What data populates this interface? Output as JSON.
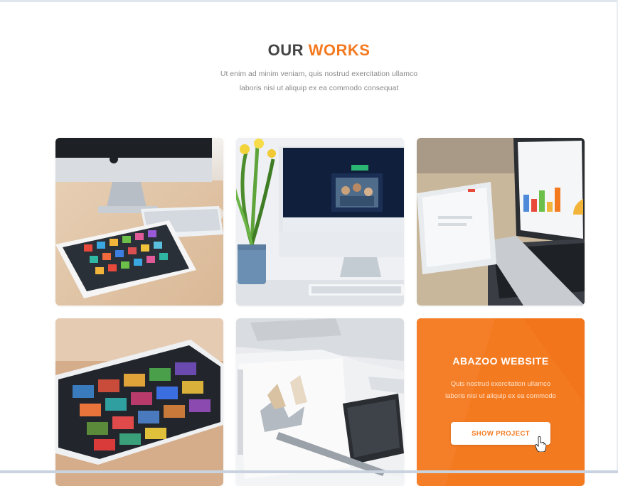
{
  "section": {
    "title_part1": "OUR ",
    "title_part2": "WORKS",
    "subtitle_line1": "Ut enim ad minim veniam, quis nostrud exercitation ullamco",
    "subtitle_line2": "laboris nisi ut aliquip ex ea commodo consequat"
  },
  "colors": {
    "accent": "#f47a20",
    "heading": "#444444",
    "text": "#8a8a8a"
  },
  "portfolio": {
    "items": [
      {
        "icon": "imac-tablet-photo"
      },
      {
        "icon": "imac-plant-photo"
      },
      {
        "icon": "laptop-tablet-chart-photo"
      },
      {
        "icon": "tablet-apps-photo"
      },
      {
        "icon": "notebook-tablet-photo"
      },
      {
        "overlay_title": "ABAZOO WEBSITE",
        "overlay_desc_line1": "Quis nostrud exercitation ullamco",
        "overlay_desc_line2": "laboris nisi ut aliquip ex ea commodo",
        "button_label": "SHOW PROJECT"
      }
    ]
  }
}
